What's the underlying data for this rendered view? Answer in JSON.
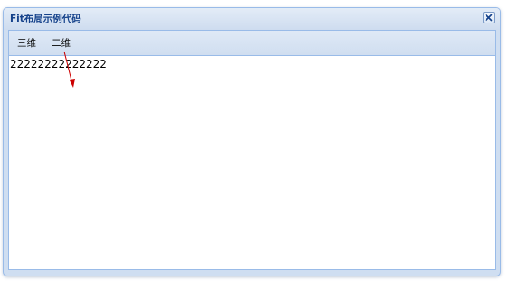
{
  "window": {
    "title": "Fit布局示例代码",
    "close_icon": "close-icon"
  },
  "toolbar": {
    "btn_3d": "三维",
    "btn_2d": "二维"
  },
  "content": {
    "text": "22222222222222"
  },
  "colors": {
    "title_text": "#15428b",
    "border": "#99bbe8",
    "header_bg": "#cfdef1",
    "annotation_arrow": "#cc0000"
  }
}
